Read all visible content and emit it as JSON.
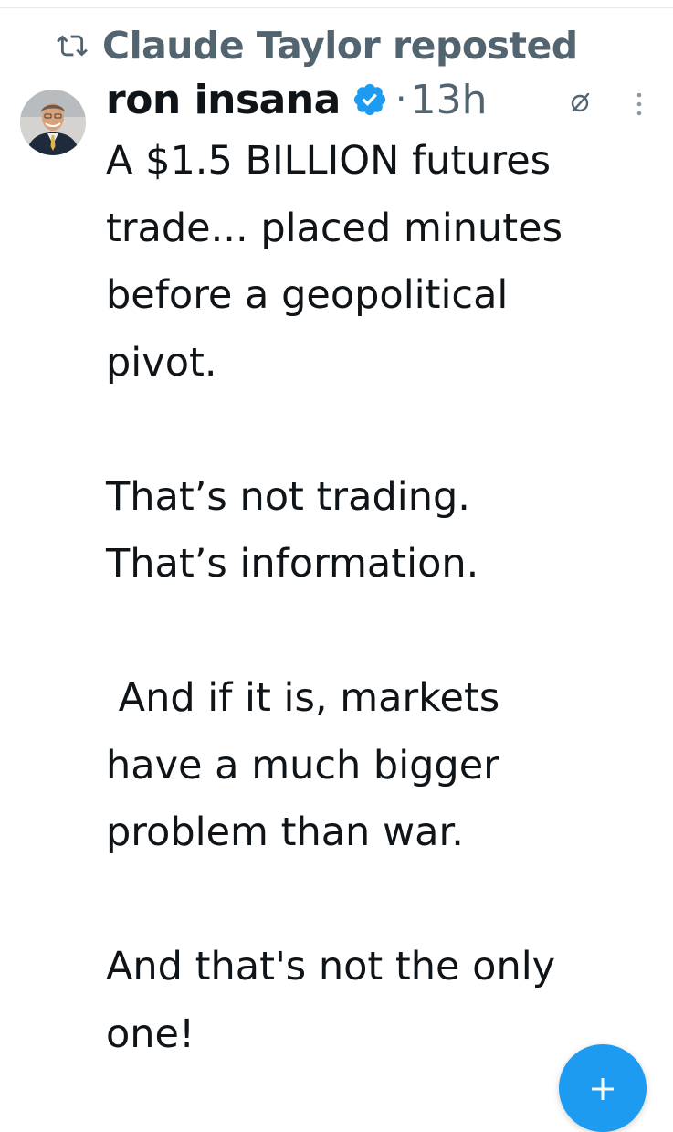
{
  "repost": {
    "text": "Claude Taylor reposted",
    "icon": "repost-icon"
  },
  "author": {
    "name": "ron insana",
    "verified": true,
    "separator": "·",
    "time": "13h",
    "avatar": "avatar"
  },
  "post": {
    "text": "A $1.5 BILLION futures\ntrade... placed minutes\nbefore a geopolitical\npivot.\n\nThat’s not trading.\nThat’s information.\n\n And if it is, markets\nhave a much bigger\nproblem than war.\n\nAnd that's not the only\none!"
  },
  "actions": {
    "grok_icon": "grok-icon",
    "more_icon": "more-icon",
    "compose_icon": "plus-icon"
  },
  "colors": {
    "text_primary": "#0f1419",
    "text_secondary": "#536471",
    "accent_blue": "#1d9bf0",
    "rule": "#e7e9ea"
  }
}
